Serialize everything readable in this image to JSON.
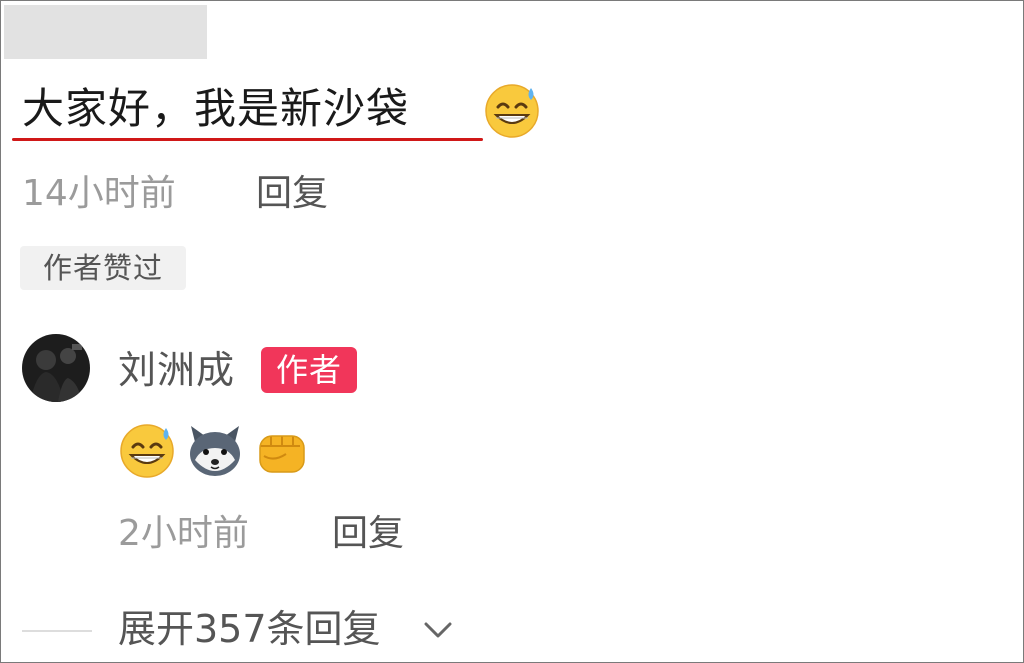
{
  "comment": {
    "text": "大家好，我是新沙袋",
    "time": "14小时前",
    "reply_label": "回复",
    "author_liked_badge": "作者赞过",
    "emoji_icon": "sweat-grin-emoji"
  },
  "reply": {
    "username": "刘洲成",
    "author_badge": "作者",
    "emojis": [
      "sweat-grin-emoji",
      "husky-dog-emoji",
      "fist-emoji"
    ],
    "time": "2小时前",
    "reply_label": "回复"
  },
  "expand": {
    "label": "展开357条回复"
  },
  "colors": {
    "underline": "#d01818",
    "author_badge": "#f1365a",
    "muted_text": "#9b9b9b"
  }
}
